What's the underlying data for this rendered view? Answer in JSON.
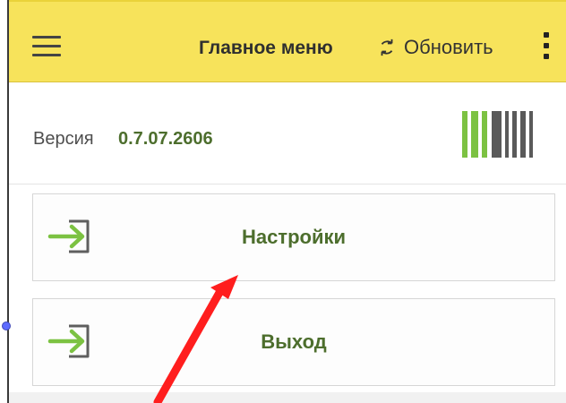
{
  "header": {
    "title": "Главное меню",
    "refresh_label": "Обновить",
    "menu_icon_name": "hamburger-menu-icon",
    "refresh_icon_name": "refresh-icon",
    "more_icon_name": "more-vertical-icon"
  },
  "version": {
    "label": "Версия",
    "value": "0.7.07.2606",
    "barcode_icon_name": "barcode-icon"
  },
  "menu": {
    "items": [
      {
        "label": "Настройки",
        "icon_name": "login-arrow-icon"
      },
      {
        "label": "Выход",
        "icon_name": "login-arrow-icon"
      }
    ]
  },
  "annotation": {
    "arrow_icon_name": "red-pointer-arrow",
    "arrow_color": "#ff1e1e"
  },
  "colors": {
    "header_bg": "#f7e35b",
    "accent_green": "#4d6e2d",
    "icon_green": "#7cc242"
  }
}
